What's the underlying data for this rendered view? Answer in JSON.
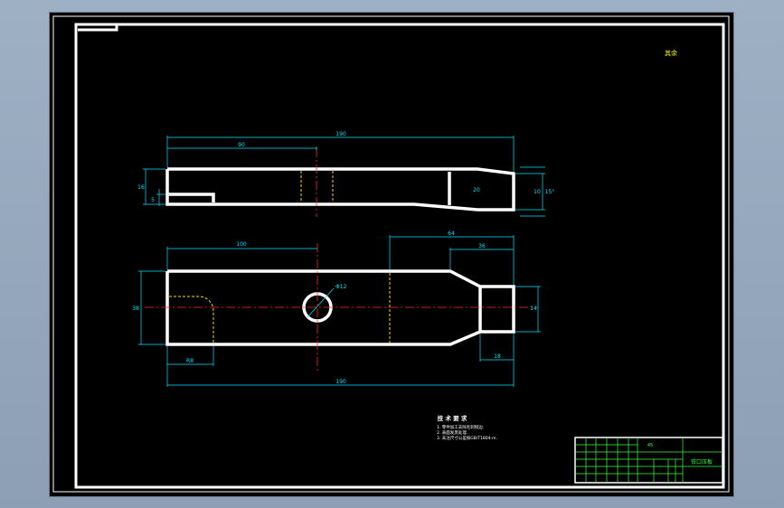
{
  "drawing": {
    "title_block": {
      "material_note": "45",
      "part_name": "钳口压板"
    },
    "corner_note": "其余",
    "technical_requirements": {
      "heading": "技 术 要 求",
      "items": [
        "1. 零件加工去除毛刺锐边.",
        "2. 表面发黑处理.",
        "3. 未注尺寸公差按GB/T1804-m."
      ]
    },
    "dimensions": {
      "top_view": {
        "overall_length": "190",
        "center_distance": "90",
        "height_left": "16",
        "slot": "5",
        "tip_height": "10",
        "right_height": "20",
        "angle": "15°"
      },
      "front_view": {
        "left_section": "100",
        "right_section": "64",
        "taper": "36",
        "height": "38",
        "hole": "Φ12",
        "corner_radius": "R8",
        "overall_length": "190",
        "tip_width": "14",
        "right_offset": "18"
      }
    }
  },
  "colors": {
    "outline": "#ffffff",
    "dimension": "#00e5ff",
    "center": "#ff2a2a",
    "hidden": "#ffd400",
    "title_block": "#3cff3c",
    "note": "#ffff00"
  }
}
